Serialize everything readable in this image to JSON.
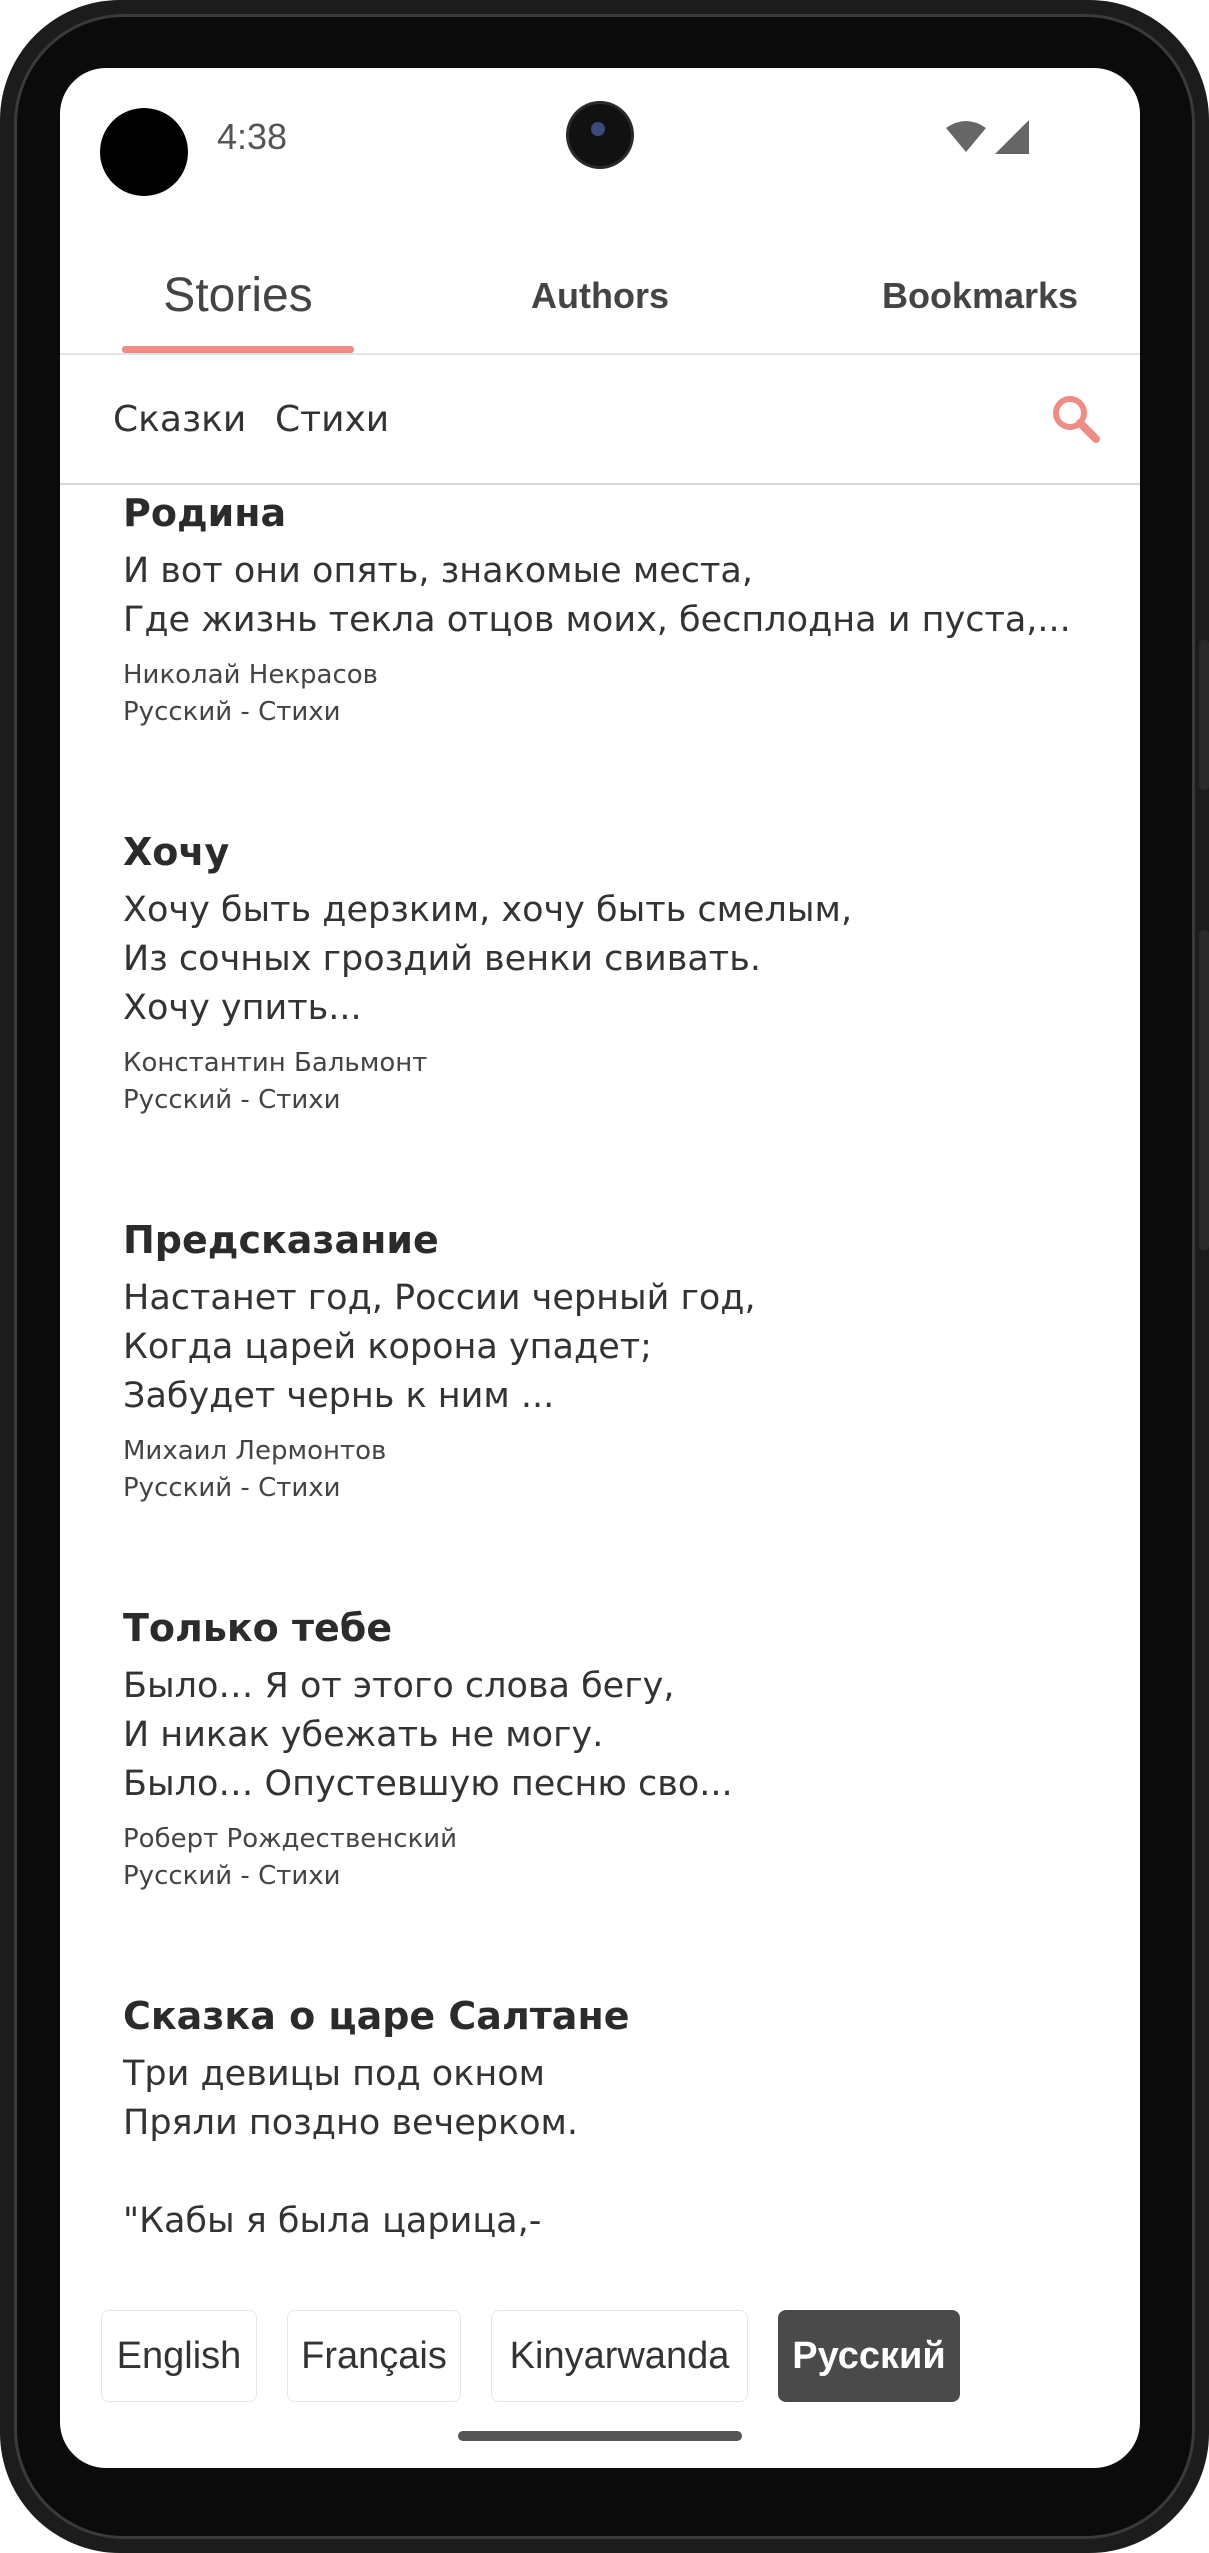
{
  "status_bar": {
    "time": "4:38",
    "icons": [
      "wifi-icon",
      "cell-signal-icon"
    ]
  },
  "tabs": [
    {
      "label": "Stories",
      "active": true
    },
    {
      "label": "Authors",
      "active": false
    },
    {
      "label": "Bookmarks",
      "active": false
    }
  ],
  "categories": [
    "Сказки",
    "Стихи"
  ],
  "search": {
    "icon": "search-icon"
  },
  "stories": [
    {
      "title": "Родина",
      "excerpt": "И вот они опять, знакомые места,\nГде жизнь текла отцов моих, бесплодна и пуста,...",
      "author": "Николай Некрасов",
      "lang_category": "Русский - Стихи"
    },
    {
      "title": "Хочу",
      "excerpt": "Хочу быть дерзким, хочу быть смелым,\nИз сочных гроздий венки свивать.\nХочу упить...",
      "author": "Константин Бальмонт",
      "lang_category": "Русский - Стихи"
    },
    {
      "title": "Предсказание",
      "excerpt": "Настанет год, России черный год,\nКогда царей корона упадет;\nЗабудет чернь к ним ...",
      "author": "Михаил Лермонтов",
      "lang_category": "Русский - Стихи"
    },
    {
      "title": "Только тебе",
      "excerpt": "Было… Я от этого слова бегу,\nИ никак убежать не могу.\nБыло… Опустевшую песню сво...",
      "author": "Роберт Рождественский",
      "lang_category": "Русский - Стихи"
    },
    {
      "title": "Сказка о царе Салтане",
      "excerpt": "Три девицы под окном\nПряли поздно вечерком.\n\n\"Кабы я была царица,-",
      "author": "",
      "lang_category": ""
    }
  ],
  "languages": [
    {
      "label": "English",
      "selected": false
    },
    {
      "label": "Français",
      "selected": false
    },
    {
      "label": "Kinyarwanda",
      "selected": false
    },
    {
      "label": "Русский",
      "selected": true
    }
  ],
  "colors": {
    "accent": "#f08c86",
    "selected_language_bg": "#4a4a4a"
  }
}
